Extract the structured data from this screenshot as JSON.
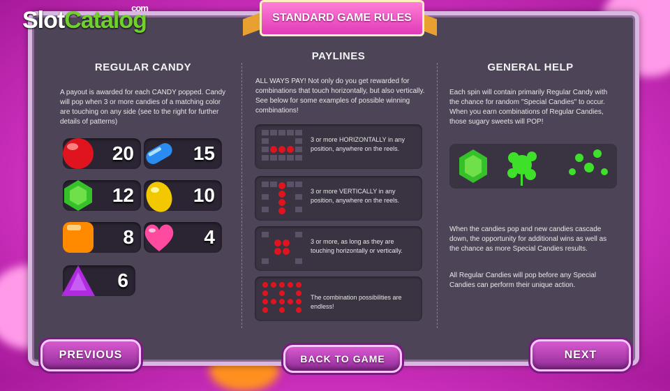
{
  "logo": {
    "part1": "Slot",
    "part2": "Catalog",
    "suffix": "com"
  },
  "banner": {
    "title": "STANDARD GAME RULES"
  },
  "regular_candy": {
    "title": "REGULAR CANDY",
    "description": "A payout is awarded for each CANDY popped. Candy will pop when 3 or more candies of a matching color are touching on any side (see to the right for further details of patterns)",
    "candies": [
      {
        "name": "red-candy",
        "value": "20",
        "color": "#e0141e"
      },
      {
        "name": "blue-candy",
        "value": "15",
        "color": "#2a8cf0"
      },
      {
        "name": "green-candy",
        "value": "12",
        "color": "#36c02a"
      },
      {
        "name": "yellow-candy",
        "value": "10",
        "color": "#f2c800"
      },
      {
        "name": "orange-candy",
        "value": "8",
        "color": "#ff8a00"
      },
      {
        "name": "pink-candy",
        "value": "4",
        "color": "#ff4aa0"
      },
      {
        "name": "purple-candy",
        "value": "6",
        "color": "#b02ae0"
      }
    ]
  },
  "paylines": {
    "title": "PAYLINES",
    "description": "ALL WAYS PAY! Not only do you get rewarded for combinations that touch horizontally, but also vertically. See below for some examples of possible winning combinations!",
    "examples": [
      {
        "text": "3 or more HORIZONTALLY in any position, anywhere on the reels."
      },
      {
        "text": "3 or more VERTICALLY in any position, anywhere on the reels."
      },
      {
        "text": "3 or more, as long as they are touching horizontally or vertically."
      },
      {
        "text": "The combination possibilities are endless!"
      }
    ]
  },
  "general_help": {
    "title": "GENERAL HELP",
    "para1": "Each spin will contain primarily Regular Candy with the chance for random \"Special Candies\" to occur. When you earn combinations of Regular Candies, those sugary sweets will POP!",
    "para2": "When the candies pop and new candies cascade down, the opportunity for additional wins as well as the chance as more Special Candies results.",
    "para3": "All Regular Candies will pop before any Special Candies can perform their unique action."
  },
  "buttons": {
    "previous": "PREVIOUS",
    "back": "BACK TO GAME",
    "next": "NEXT"
  }
}
